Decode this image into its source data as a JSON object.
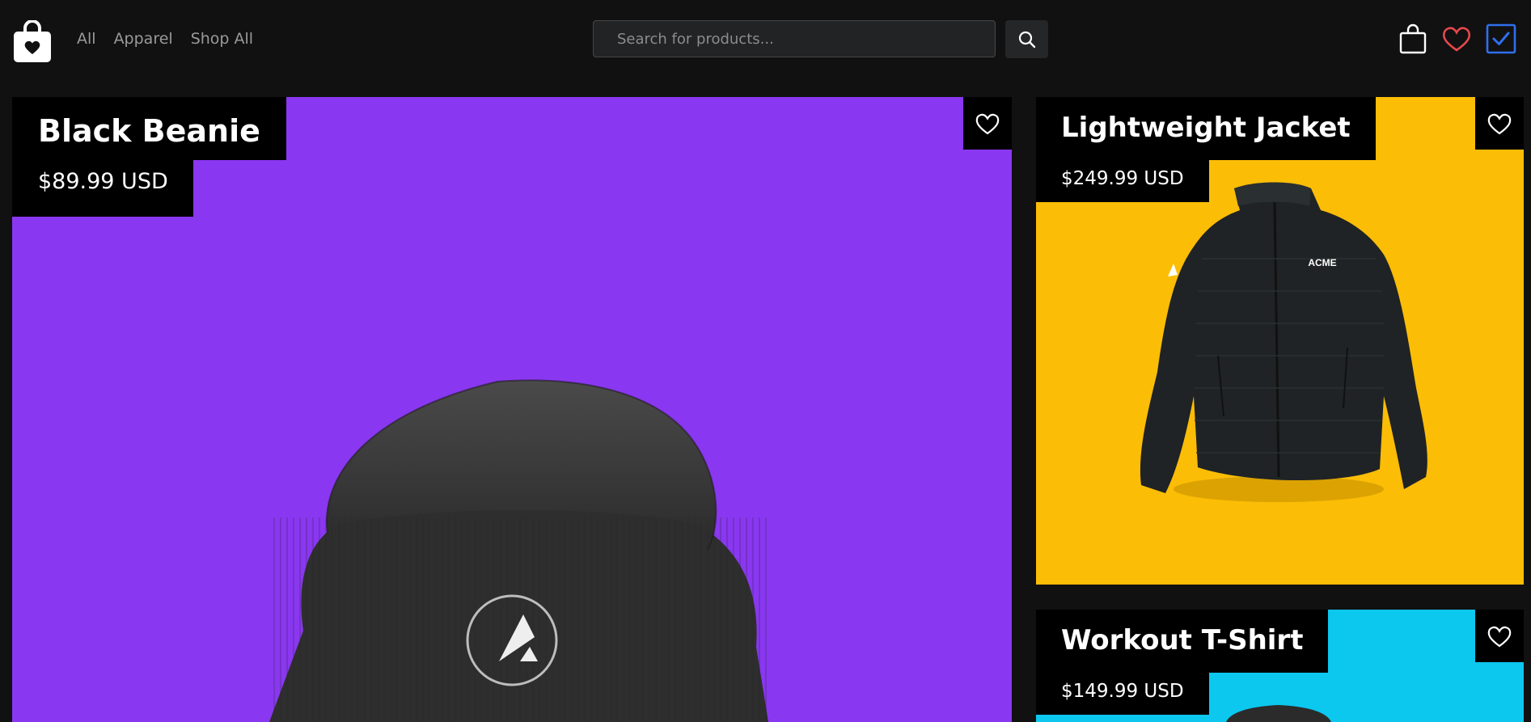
{
  "header": {
    "logo_icon": "shopping-bag-heart-icon",
    "nav": [
      {
        "label": "All"
      },
      {
        "label": "Apparel"
      },
      {
        "label": "Shop All"
      }
    ],
    "search": {
      "placeholder": "Search for products...",
      "value": "",
      "button_icon": "search-icon"
    },
    "actions": [
      {
        "icon": "shopping-bag-icon"
      },
      {
        "icon": "heart-icon",
        "color": "#e5484d"
      },
      {
        "icon": "checkbox-icon",
        "color": "#2f6fed"
      }
    ]
  },
  "products": [
    {
      "name": "Black Beanie",
      "price": "$89.99 USD",
      "background": "#8a37f1",
      "favorite_icon": "heart-outline-icon",
      "image": "beanie-image"
    },
    {
      "name": "Lightweight Jacket",
      "price": "$249.99 USD",
      "background": "#fcbd06",
      "favorite_icon": "heart-outline-icon",
      "image": "jacket-image",
      "image_text": "ACME"
    },
    {
      "name": "Workout T-Shirt",
      "price": "$149.99 USD",
      "background": "#0cc7ee",
      "favorite_icon": "heart-outline-icon",
      "image": "tshirt-image"
    }
  ]
}
